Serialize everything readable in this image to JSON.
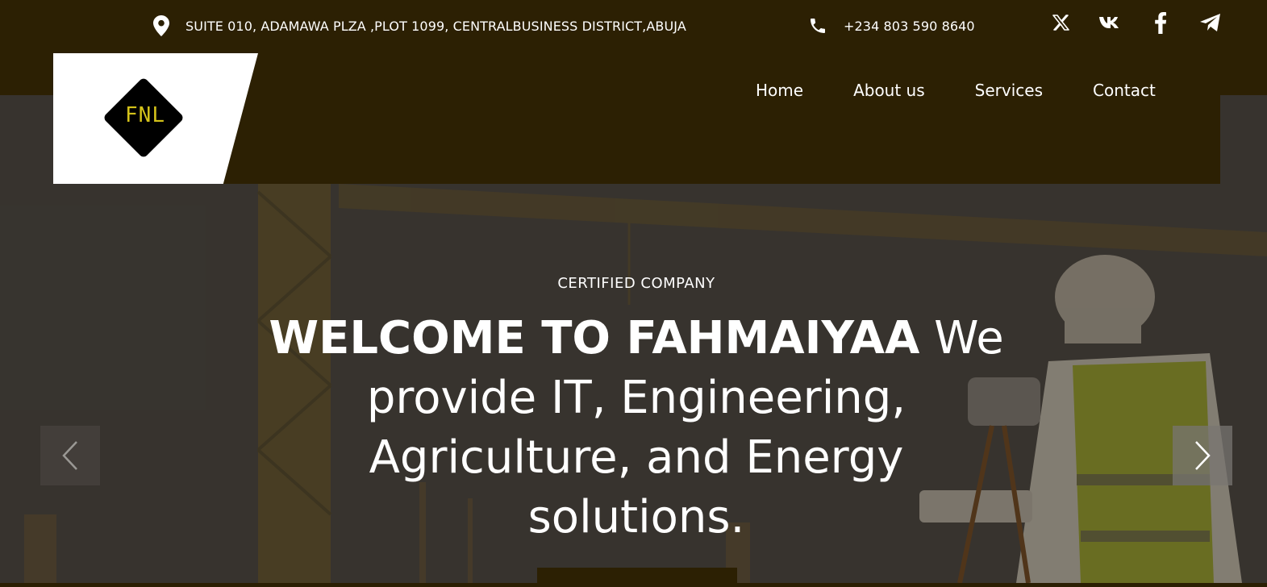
{
  "topbar": {
    "address": "SUITE 010, ADAMAWA PLZA ,PLOT 1099, CENTRALBUSINESS DISTRICT,ABUJA",
    "phone": "+234 803 590 8640",
    "socials": [
      "x-twitter-icon",
      "vk-icon",
      "facebook-icon",
      "telegram-icon"
    ]
  },
  "logo": {
    "text": "FNL"
  },
  "nav": {
    "items": [
      {
        "label": "Home"
      },
      {
        "label": "About us"
      },
      {
        "label": "Services"
      },
      {
        "label": "Contact"
      }
    ]
  },
  "hero": {
    "eyebrow": "CERTIFIED COMPANY",
    "title_bold": "WELCOME TO FAHMAIYAA",
    "title_rest": "We provide IT, Engineering, Agriculture, and Energy solutions."
  },
  "colors": {
    "brand_dark": "#2c2003",
    "logo_accent": "#d4c21a",
    "text": "#ffffff"
  }
}
